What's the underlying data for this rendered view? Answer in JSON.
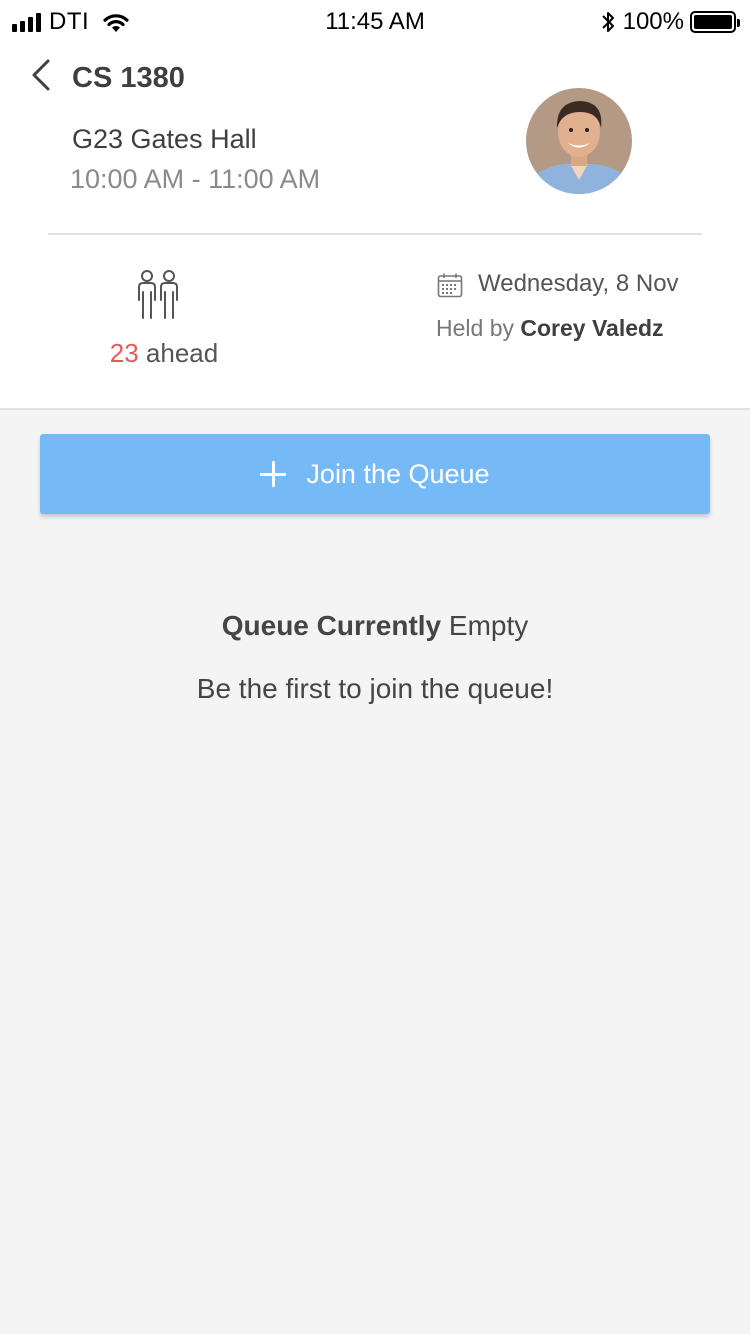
{
  "status_bar": {
    "carrier": "DTI",
    "time": "11:45 AM",
    "battery": "100%",
    "battery_level": 1.0
  },
  "header": {
    "back_icon": "chevron-left-icon",
    "course": "CS 1380",
    "location": "G23 Gates Hall",
    "time_range": "10:00 AM - 11:00 AM",
    "avatar_icon": "tutor-avatar"
  },
  "queue_info": {
    "people_icon": "people-icon",
    "ahead_count": "23",
    "ahead_label": "ahead",
    "calendar_icon": "calendar-icon",
    "date": "Wednesday, 8 Nov",
    "held_by_prefix": "Held by",
    "host": "Corey Valedz"
  },
  "actions": {
    "join_label": "Join the Queue",
    "join_icon": "plus-icon"
  },
  "empty_state": {
    "title_part1": "Queue Currently",
    "title_part2": "Empty",
    "message": "Be the first to join the queue!"
  },
  "colors": {
    "accent": "#76b9f7",
    "highlight": "#e75a5a",
    "background": "#f4f4f4"
  }
}
